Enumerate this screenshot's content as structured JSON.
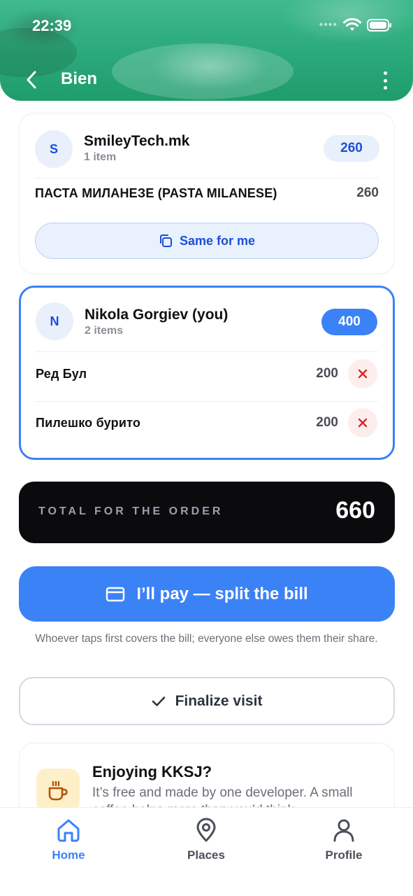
{
  "status_bar": {
    "time": "22:39"
  },
  "header": {
    "title": "Bien"
  },
  "participants": [
    {
      "initial": "S",
      "name": "SmileyTech.mk",
      "count": "1 item",
      "total": "260",
      "items": [
        {
          "name": "ПАСТА МИЛАНЕЗЕ (PASTA MILANESE)",
          "price": "260"
        }
      ],
      "action_label": "Same for me"
    },
    {
      "initial": "N",
      "name": "Nikola Gorgiev (you)",
      "count": "2 items",
      "total": "400",
      "items": [
        {
          "name": "Ред Бул",
          "price": "200"
        },
        {
          "name": "Пилешко бурито",
          "price": "200"
        }
      ]
    }
  ],
  "total": {
    "label": "TOTAL FOR THE ORDER",
    "value": "660"
  },
  "pay": {
    "label": "I’ll pay — split the bill",
    "note": "Whoever taps first covers the bill; everyone else owes them their share."
  },
  "finalize": {
    "label": "Finalize visit"
  },
  "promo": {
    "title": "Enjoying KKSJ?",
    "text": "It’s free and made by one developer. A small coffee helps more than you’d think."
  },
  "nav": {
    "items": [
      {
        "label": "Home",
        "icon": "home-icon",
        "active": true
      },
      {
        "label": "Places",
        "icon": "map-pin-icon",
        "active": false
      },
      {
        "label": "Profile",
        "icon": "user-icon",
        "active": false
      }
    ]
  },
  "colors": {
    "accent": "#3b82f6",
    "header_green": "#2aa97a",
    "danger": "#dc2626",
    "total_bg": "#0b0b0d"
  }
}
